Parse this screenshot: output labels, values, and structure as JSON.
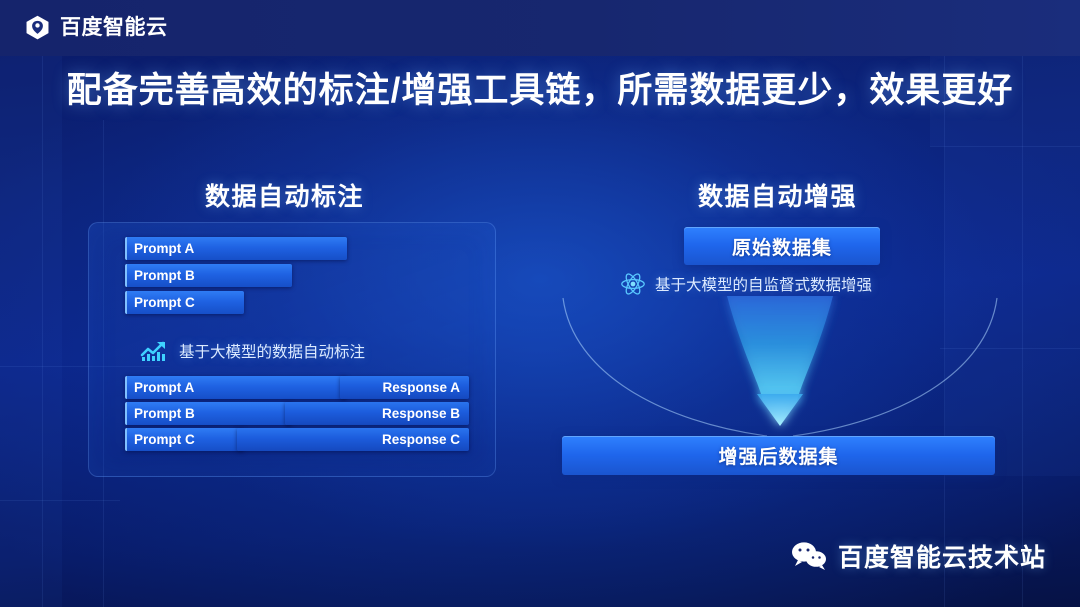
{
  "brand": {
    "name": "百度智能云",
    "logo_icon": "baidu-cloud-hexagon-logo"
  },
  "title": "配备完善高效的标注/增强工具链，所需数据更少，效果更好",
  "left_section": {
    "heading": "数据自动标注",
    "input_bars": [
      {
        "label": "Prompt A"
      },
      {
        "label": "Prompt B"
      },
      {
        "label": "Prompt C"
      }
    ],
    "caption": {
      "icon": "growth-chart-icon",
      "text": "基于大模型的数据自动标注"
    },
    "paired_rows": [
      {
        "prompt": "Prompt A",
        "response": "Response A"
      },
      {
        "prompt": "Prompt B",
        "response": "Response B"
      },
      {
        "prompt": "Prompt C",
        "response": "Response C"
      }
    ]
  },
  "right_section": {
    "heading": "数据自动增强",
    "source_button": "原始数据集",
    "caption": {
      "icon": "atom-icon",
      "text": "基于大模型的自监督式数据增强"
    },
    "flow_icon": "down-arrow-funnel-icon",
    "result_button": "增强后数据集"
  },
  "watermark": {
    "icon": "wechat-icon",
    "text": "百度智能云技术站"
  },
  "colors": {
    "background_deep": "#0a1a66",
    "top_band": "#16256e",
    "bar_blue": "#1f62e2",
    "accent_cyan": "#7fd4ff",
    "text_white": "#ffffff"
  }
}
